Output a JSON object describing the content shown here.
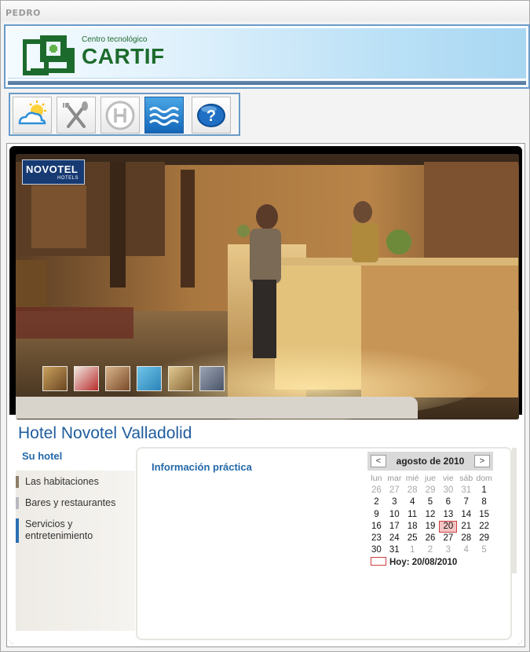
{
  "window": {
    "title": "PEDRO"
  },
  "banner": {
    "logo_subtitle": "Centro tecnológico",
    "logo_name": "CARTIF"
  },
  "toolbar": {
    "buttons": [
      {
        "icon": "weather-icon"
      },
      {
        "icon": "restaurant-icon"
      },
      {
        "icon": "hotel-icon"
      },
      {
        "icon": "waves-icon",
        "active": true
      },
      {
        "icon": "help-icon"
      }
    ]
  },
  "hotel": {
    "badge_brand": "NOVOTEL",
    "badge_sub": "HOTELS",
    "title": "Hotel Novotel Valladolid",
    "sidebar_heading": "Su hotel",
    "menu": [
      {
        "label": "Las habitaciones",
        "color": "#8b7d68"
      },
      {
        "label": "Bares y restaurantes",
        "color": "#b8b8c0"
      },
      {
        "label": "Servicios y entretenimiento",
        "color": "#2a6fb2"
      }
    ],
    "info_heading": "Información práctica"
  },
  "calendar": {
    "title": "agosto de 2010",
    "prev": "<",
    "next": ">",
    "dow": [
      "lun",
      "mar",
      "mié",
      "jue",
      "vie",
      "sáb",
      "dom"
    ],
    "weeks": [
      [
        "26",
        "27",
        "28",
        "29",
        "30",
        "31",
        "1"
      ],
      [
        "2",
        "3",
        "4",
        "5",
        "6",
        "7",
        "8"
      ],
      [
        "9",
        "10",
        "11",
        "12",
        "13",
        "14",
        "15"
      ],
      [
        "16",
        "17",
        "18",
        "19",
        "20",
        "21",
        "22"
      ],
      [
        "23",
        "24",
        "25",
        "26",
        "27",
        "28",
        "29"
      ],
      [
        "30",
        "31",
        "1",
        "2",
        "3",
        "4",
        "5"
      ]
    ],
    "today_label": "Hoy: 20/08/2010"
  }
}
